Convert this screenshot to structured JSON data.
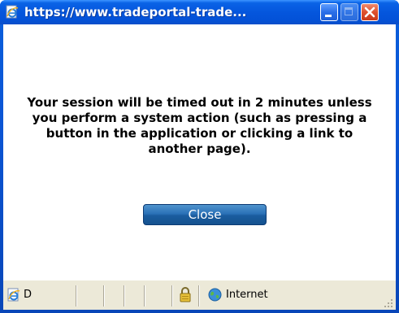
{
  "window": {
    "title": "https://www.tradeportal-trade..."
  },
  "icons": {
    "title_icon": "ie-page-icon",
    "minimize": "minimize-icon",
    "maximize": "maximize-icon",
    "close": "close-icon",
    "status_page": "ie-page-icon",
    "lock": "padlock-icon",
    "zone": "globe-icon",
    "grip": "resize-grip-icon"
  },
  "dialog": {
    "message": "Your session will be timed out in 2 minutes unless you perform a system action (such as pressing a button in the application or clicking a link to another page).",
    "close_label": "Close"
  },
  "statusbar": {
    "text": "D",
    "zone": "Internet"
  },
  "colors": {
    "titlebar": "#0556dd",
    "close_button": "#1a5c9f",
    "close_titlebar_button": "#de4f2c",
    "statusbar": "#ece9d8"
  }
}
